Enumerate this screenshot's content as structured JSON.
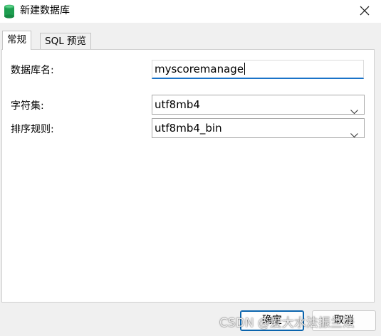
{
  "window": {
    "title": "新建数据库",
    "icon": "database-icon",
    "close_icon": "close-icon"
  },
  "tabs": [
    {
      "label": "常规",
      "active": true
    },
    {
      "label": "SQL 预览",
      "active": false
    }
  ],
  "form": {
    "db_name": {
      "label": "数据库名:",
      "value": "myscoremanage"
    },
    "charset": {
      "label": "字符集:",
      "value": "utf8mb4"
    },
    "collation": {
      "label": "排序规则:",
      "value": "utf8mb4_bin"
    }
  },
  "buttons": {
    "ok": "确定",
    "cancel": "取消"
  },
  "watermark": "CSDN @爱大水法振兰法",
  "colors": {
    "accent": "#1a73c8",
    "icon_green": "#1e9e50",
    "background": "#f0f0f0"
  }
}
